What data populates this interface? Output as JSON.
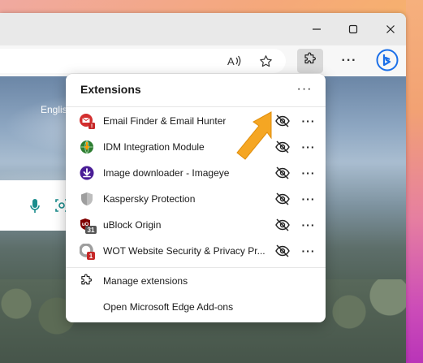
{
  "window": {
    "minimize_icon": "minimize-icon",
    "maximize_icon": "maximize-icon",
    "close_icon": "close-icon"
  },
  "toolbar": {
    "read_aloud_icon": "read-aloud-icon",
    "favorite_icon": "star-icon",
    "extensions_icon": "puzzle-icon",
    "more_icon": "more-icon",
    "bing_icon": "bing-icon"
  },
  "page": {
    "language_text": "Englis"
  },
  "extensions_popup": {
    "title": "Extensions",
    "items": [
      {
        "name": "Email Finder & Email Hunter",
        "icon": "email-finder-icon"
      },
      {
        "name": "IDM Integration Module",
        "icon": "idm-icon"
      },
      {
        "name": "Image downloader - Imageye",
        "icon": "imageye-icon"
      },
      {
        "name": "Kaspersky Protection",
        "icon": "kaspersky-icon"
      },
      {
        "name": "uBlock Origin",
        "icon": "ublock-icon",
        "badge": "31"
      },
      {
        "name": "WOT Website Security & Privacy Pr...",
        "icon": "wot-icon",
        "badge": "1"
      }
    ],
    "manage_label": "Manage extensions",
    "addons_label": "Open Microsoft Edge Add-ons"
  },
  "colors": {
    "arrow": "#f5a623",
    "popup_bg": "#ffffff",
    "bing_blue": "#1b6fe8"
  }
}
